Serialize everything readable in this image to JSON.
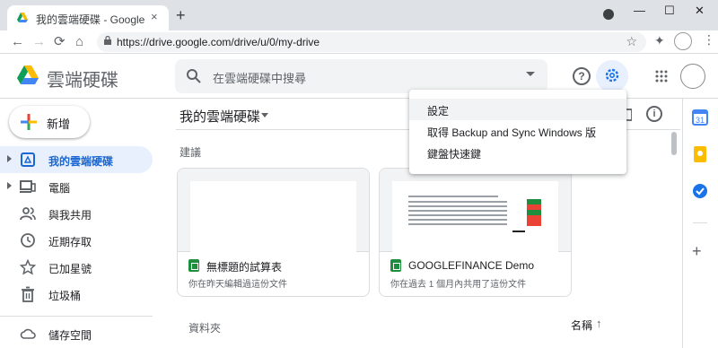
{
  "browser": {
    "tab_title": "我的雲端硬碟 - Google 雲端硬碟",
    "tab_close": "×",
    "new_tab": "+",
    "window_controls": [
      "—",
      "☐",
      "✕"
    ],
    "url": "https://drive.google.com/drive/u/0/my-drive",
    "nav": {
      "back": "←",
      "forward": "→",
      "reload": "⟳",
      "home": "⌂"
    },
    "star": "☆",
    "extensions": "✦",
    "menu": "⋮"
  },
  "header": {
    "app_title": "雲端硬碟",
    "search_placeholder": "在雲端硬碟中搜尋",
    "help": "?"
  },
  "sidebar": {
    "new_label": "新增",
    "items": [
      {
        "label": "我的雲端硬碟",
        "icon": "drive-icon",
        "active": true,
        "expandable": true
      },
      {
        "label": "電腦",
        "icon": "computer-icon",
        "active": false,
        "expandable": true
      },
      {
        "label": "與我共用",
        "icon": "shared-icon",
        "active": false,
        "expandable": false
      },
      {
        "label": "近期存取",
        "icon": "clock-icon",
        "active": false,
        "expandable": false
      },
      {
        "label": "已加星號",
        "icon": "star-icon",
        "active": false,
        "expandable": false
      },
      {
        "label": "垃圾桶",
        "icon": "trash-icon",
        "active": false,
        "expandable": false
      },
      {
        "label": "儲存空間",
        "icon": "cloud-icon",
        "active": false,
        "expandable": false
      }
    ]
  },
  "main": {
    "title": "我的雲端硬碟",
    "info": "i",
    "suggested_label": "建議",
    "cards": [
      {
        "name": "無標題的試算表",
        "subtitle": "你在昨天編輯過這份文件"
      },
      {
        "name": "GOOGLEFINANCE Demo",
        "subtitle": "你在過去 1 個月內共用了這份文件"
      }
    ],
    "folders_label": "資料夾",
    "sort_label": "名稱",
    "sort_arrow": "↑"
  },
  "settings_menu": {
    "items": [
      "設定",
      "取得 Backup and Sync Windows 版",
      "鍵盤快速鍵"
    ]
  },
  "right_rail": {
    "add": "+"
  },
  "colors": {
    "accent_blue": "#1a73e8",
    "active_bg": "#e8f0fe",
    "sheets_green": "#1e8e3e"
  }
}
